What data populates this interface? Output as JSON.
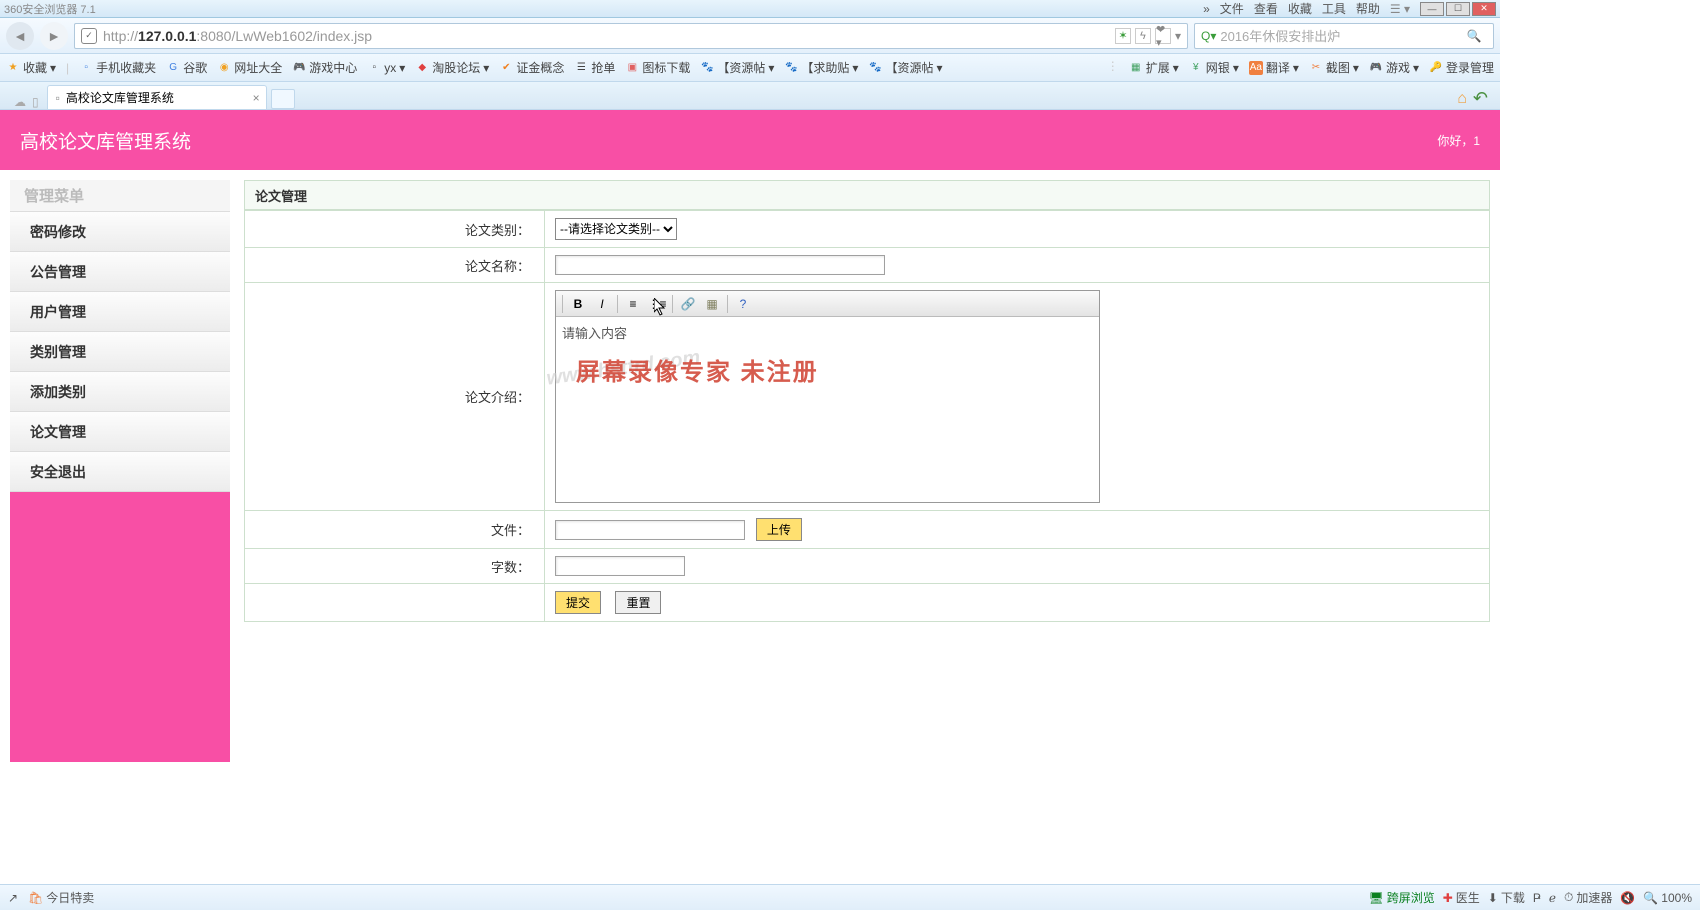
{
  "browser": {
    "title": "360安全浏览器 7.1",
    "menus": [
      "文件",
      "查看",
      "收藏",
      "工具",
      "帮助"
    ],
    "url_prefix": "http://",
    "url_host": "127.0.0.1",
    "url_path": ":8080/LwWeb1602/index.jsp",
    "search_placeholder": "2016年休假安排出炉",
    "chevrons": "»"
  },
  "bookmarks": {
    "favorite": "收藏",
    "items": [
      "手机收藏夹",
      "谷歌",
      "网址大全",
      "游戏中心",
      "yx",
      "淘股论坛",
      "证金概念",
      "抢单",
      "图标下载",
      "【资源帖",
      "【求助贴",
      "【资源帖"
    ],
    "right": [
      "扩展",
      "网银",
      "翻译",
      "截图",
      "游戏",
      "登录管理"
    ]
  },
  "tab": {
    "title": "高校论文库管理系统"
  },
  "page": {
    "title": "高校论文库管理系统",
    "greeting": "你好，1"
  },
  "sidebar": {
    "title": "管理菜单",
    "items": [
      "密码修改",
      "公告管理",
      "用户管理",
      "类别管理",
      "添加类别",
      "论文管理",
      "安全退出"
    ]
  },
  "form": {
    "panel_title": "论文管理",
    "labels": {
      "category": "论文类别：",
      "name": "论文名称：",
      "intro": "论文介绍：",
      "file": "文件：",
      "words": "字数："
    },
    "category_placeholder": "--请选择论文类别--",
    "editor_placeholder": "请输入内容",
    "upload": "上传",
    "submit": "提交",
    "reset": "重置"
  },
  "watermark": {
    "text1": "屏幕录像专家  未注册",
    "text2": "www.hsttrd.com"
  },
  "status": {
    "today": "今日特卖",
    "cross": "跨屏浏览",
    "doctor": "医生",
    "download": "下载",
    "accel": "加速器",
    "zoom": "100%"
  }
}
